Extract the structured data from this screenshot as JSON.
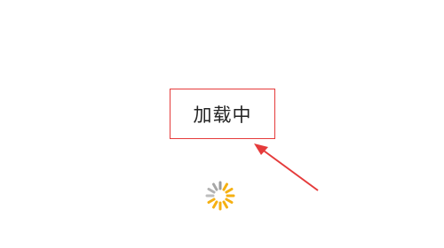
{
  "loading": {
    "text": "加载中",
    "status": "loading",
    "spinner_icon": "spinner-icon",
    "spinner_colors": {
      "accent": "#f5b012",
      "muted": "#8a8a8a"
    }
  },
  "annotation": {
    "type": "callout",
    "color": "#e53b3b",
    "arrow_icon": "red-arrow-icon"
  }
}
